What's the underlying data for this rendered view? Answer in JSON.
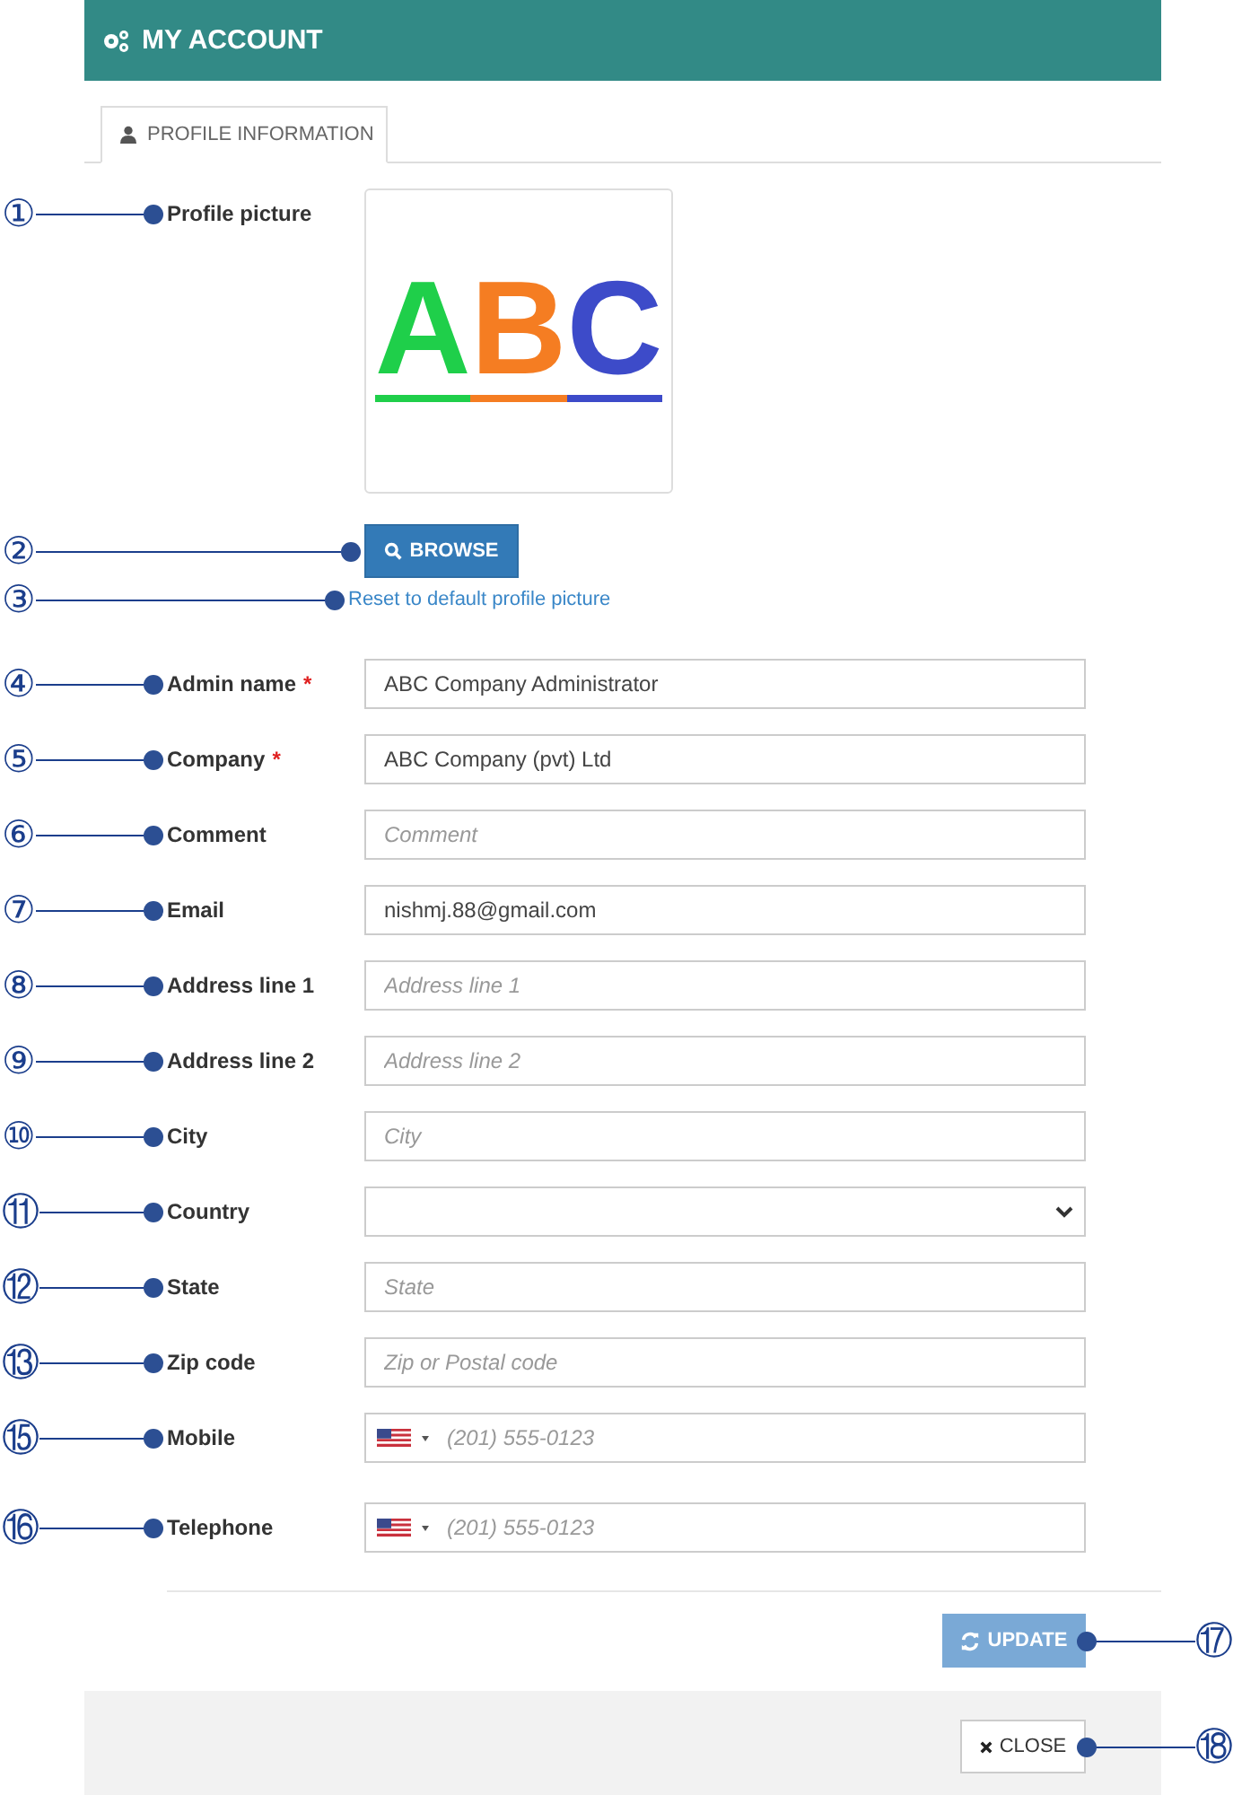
{
  "window": {
    "title": "MY ACCOUNT"
  },
  "tabs": [
    {
      "label": "PROFILE INFORMATION",
      "selected": true
    }
  ],
  "profile_picture": {
    "callout": "①",
    "label": "Profile picture",
    "letters": [
      {
        "text": "A",
        "color": "#1fcf4a"
      },
      {
        "text": "B",
        "color": "#f57d22"
      },
      {
        "text": "C",
        "color": "#3d4bc9"
      }
    ]
  },
  "browse_button": {
    "callout": "②",
    "label": "BROWSE"
  },
  "reset_link": {
    "callout": "③",
    "label": "Reset to default profile picture"
  },
  "fields": [
    {
      "callout": "④",
      "label": "Admin name",
      "required_mark": "*",
      "kind": "text",
      "value": "ABC Company Administrator"
    },
    {
      "callout": "⑤",
      "label": "Company",
      "required_mark": "*",
      "kind": "text",
      "value": "ABC Company (pvt) Ltd"
    },
    {
      "callout": "⑥",
      "label": "Comment",
      "kind": "text",
      "placeholder": "Comment"
    },
    {
      "callout": "⑦",
      "label": "Email",
      "kind": "text",
      "value": "nishmj.88@gmail.com"
    },
    {
      "callout": "⑧",
      "label": "Address line 1",
      "kind": "text",
      "placeholder": "Address line 1"
    },
    {
      "callout": "⑨",
      "label": "Address line 2",
      "kind": "text",
      "placeholder": "Address line 2"
    },
    {
      "callout": "⑩",
      "label": "City",
      "kind": "text",
      "placeholder": "City"
    },
    {
      "callout": "⑪",
      "label": "Country",
      "kind": "select"
    },
    {
      "callout": "⑫",
      "label": "State",
      "kind": "text",
      "placeholder": "State"
    },
    {
      "callout": "⑬",
      "label": "Zip code",
      "kind": "text",
      "placeholder": "Zip or Postal code"
    },
    {
      "callout": "⑮",
      "label": "Mobile",
      "kind": "phone",
      "placeholder": "(201) 555-0123"
    },
    {
      "callout": "⑯",
      "label": "Telephone",
      "kind": "phone",
      "placeholder": "(201) 555-0123"
    }
  ],
  "update_button": {
    "callout": "⑰",
    "label": "UPDATE",
    "disabled": true
  },
  "close_button": {
    "callout": "⑱",
    "label": "CLOSE"
  }
}
